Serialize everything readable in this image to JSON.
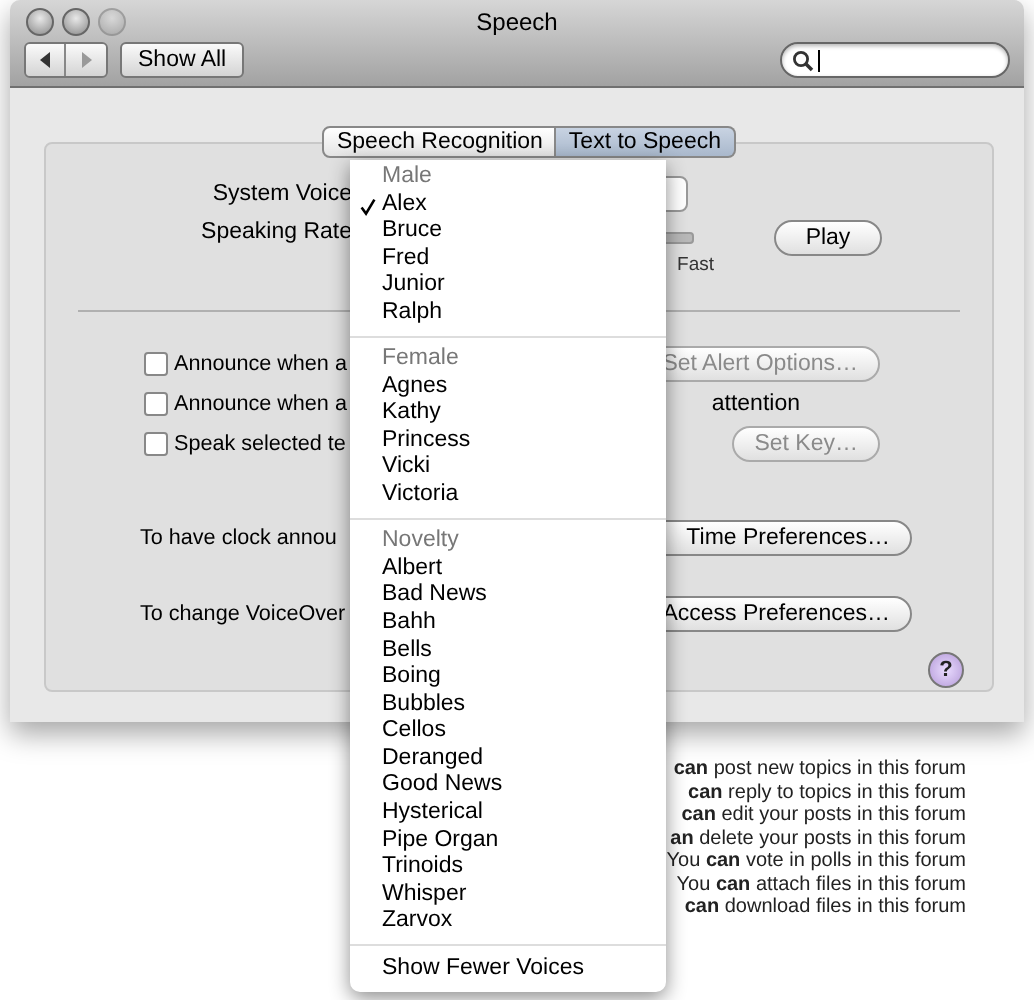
{
  "window": {
    "title": "Speech",
    "toolbar": {
      "show_all": "Show All"
    }
  },
  "tabs": [
    {
      "label": "Speech Recognition",
      "selected": false
    },
    {
      "label": "Text to Speech",
      "selected": true
    }
  ],
  "system_voice": {
    "label": "System Voice"
  },
  "speaking_rate": {
    "label": "Speaking Rate",
    "ticks": [
      "Fast"
    ],
    "play": "Play"
  },
  "options": [
    {
      "label": "Announce when a",
      "checked": false,
      "button": "Set Alert Options…",
      "disabled": true
    },
    {
      "label": "Announce when a",
      "label_end": "attention",
      "checked": false
    },
    {
      "label": "Speak selected te",
      "checked": false,
      "button": "Set Key…",
      "disabled": true
    }
  ],
  "links": [
    {
      "label": "To have clock annou",
      "button": "Time Preferences…"
    },
    {
      "label": "To change VoiceOver",
      "button": "Access Preferences…"
    }
  ],
  "help_button": "?",
  "voice_menu": {
    "groups": [
      {
        "header": "Male",
        "items": [
          {
            "label": "Alex",
            "selected": true
          },
          {
            "label": "Bruce",
            "selected": false
          },
          {
            "label": "Fred",
            "selected": false
          },
          {
            "label": "Junior",
            "selected": false
          },
          {
            "label": "Ralph",
            "selected": false
          }
        ]
      },
      {
        "header": "Female",
        "items": [
          {
            "label": "Agnes",
            "selected": false
          },
          {
            "label": "Kathy",
            "selected": false
          },
          {
            "label": "Princess",
            "selected": false
          },
          {
            "label": "Vicki",
            "selected": false
          },
          {
            "label": "Victoria",
            "selected": false
          }
        ]
      },
      {
        "header": "Novelty",
        "items": [
          {
            "label": "Albert",
            "selected": false
          },
          {
            "label": "Bad News",
            "selected": false
          },
          {
            "label": "Bahh",
            "selected": false
          },
          {
            "label": "Bells",
            "selected": false
          },
          {
            "label": "Boing",
            "selected": false
          },
          {
            "label": "Bubbles",
            "selected": false
          },
          {
            "label": "Cellos",
            "selected": false
          },
          {
            "label": "Deranged",
            "selected": false
          },
          {
            "label": "Good News",
            "selected": false
          },
          {
            "label": "Hysterical",
            "selected": false
          },
          {
            "label": "Pipe Organ",
            "selected": false
          },
          {
            "label": "Trinoids",
            "selected": false
          },
          {
            "label": "Whisper",
            "selected": false
          },
          {
            "label": "Zarvox",
            "selected": false
          }
        ]
      }
    ],
    "footer": "Show Fewer Voices"
  },
  "forum_permissions": [
    "**can** post new topics in this forum",
    "**can** reply to topics in this forum",
    "**can** edit your posts in this forum",
    "**an** delete your posts in this forum",
    "You **can** vote in polls in this forum",
    "You **can** attach files in this forum",
    "**can** download files in this forum"
  ]
}
